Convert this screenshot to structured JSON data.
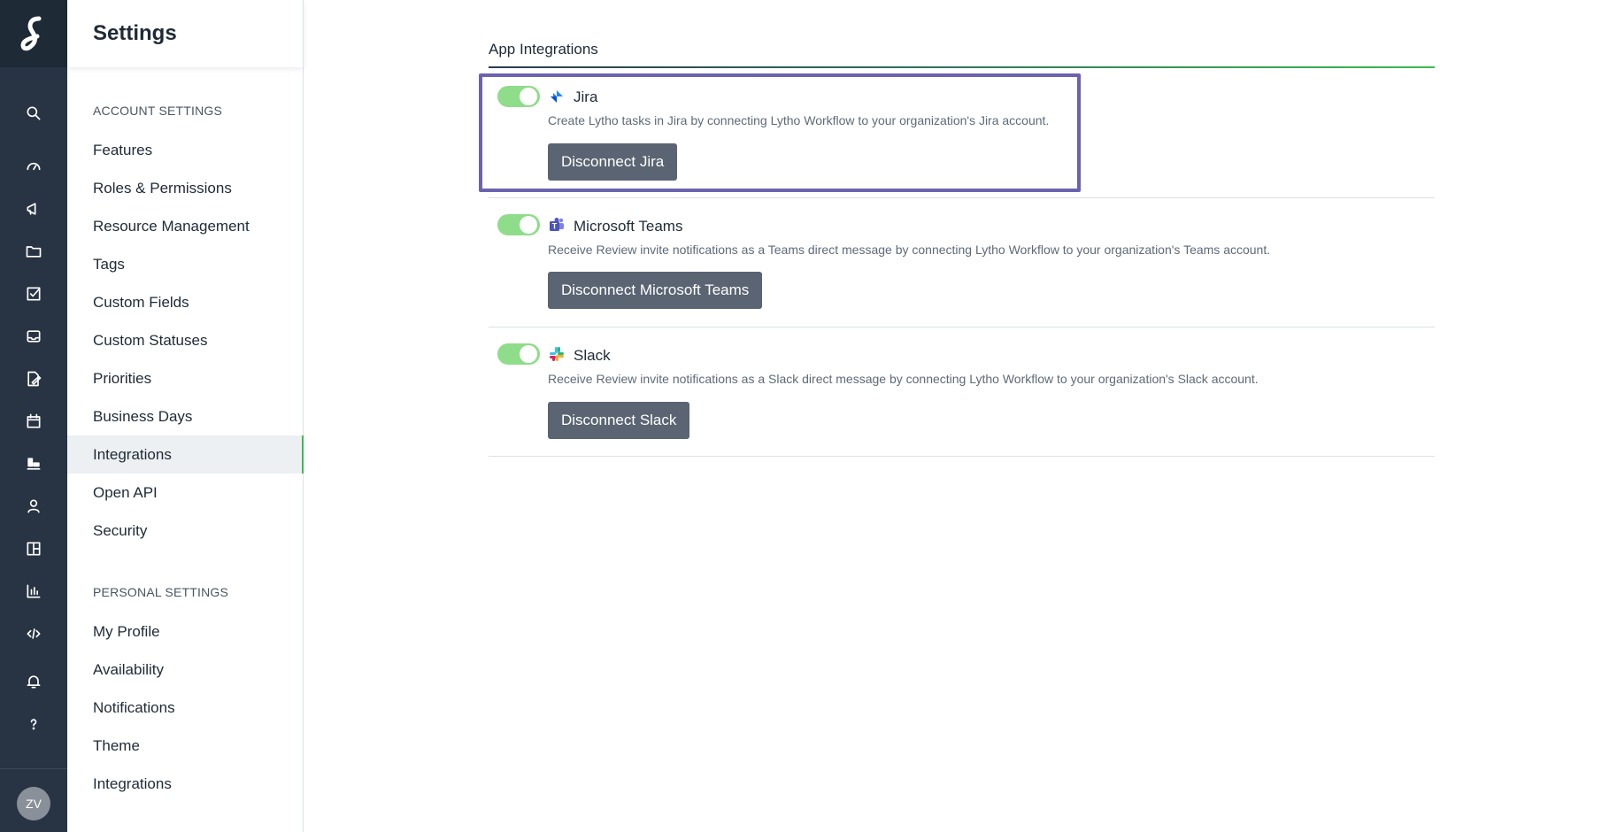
{
  "rail": {
    "logo": "lytho-logo",
    "icons": [
      "search-icon",
      "gauge-icon",
      "megaphone-icon",
      "folder-icon",
      "task-check-icon",
      "inbox-icon",
      "proof-edit-icon",
      "calendar-icon",
      "board-icon",
      "user-icon",
      "layout-icon",
      "chart-icon",
      "code-icon",
      "bell-icon",
      "help-icon"
    ],
    "avatar_initials": "ZV"
  },
  "sidebar": {
    "title": "Settings",
    "account_section": "ACCOUNT SETTINGS",
    "account_items": [
      "Features",
      "Roles & Permissions",
      "Resource Management",
      "Tags",
      "Custom Fields",
      "Custom Statuses",
      "Priorities",
      "Business Days",
      "Integrations",
      "Open API",
      "Security"
    ],
    "personal_section": "PERSONAL SETTINGS",
    "personal_items": [
      "My Profile",
      "Availability",
      "Notifications",
      "Theme",
      "Integrations"
    ],
    "active_item": "Integrations"
  },
  "main": {
    "tab_title": "App Integrations",
    "integrations": [
      {
        "name": "Jira",
        "description": "Create Lytho tasks in Jira by connecting Lytho Workflow to your organization's Jira account.",
        "button": "Disconnect Jira",
        "enabled": true,
        "icon": "jira-icon"
      },
      {
        "name": "Microsoft Teams",
        "description": "Receive Review invite notifications as a Teams direct message by connecting Lytho Workflow to your organization's Teams account.",
        "button": "Disconnect Microsoft Teams",
        "enabled": true,
        "icon": "teams-icon"
      },
      {
        "name": "Slack",
        "description": "Receive Review invite notifications as a Slack direct message by connecting Lytho Workflow to your organization's Slack account.",
        "button": "Disconnect Slack",
        "enabled": true,
        "icon": "slack-icon"
      }
    ]
  },
  "colors": {
    "rail_bg": "#283444",
    "accent_green": "#3fb950",
    "toggle_on": "#8fdc8a",
    "button_bg": "#5a6472",
    "highlight": "#6b63b0"
  }
}
